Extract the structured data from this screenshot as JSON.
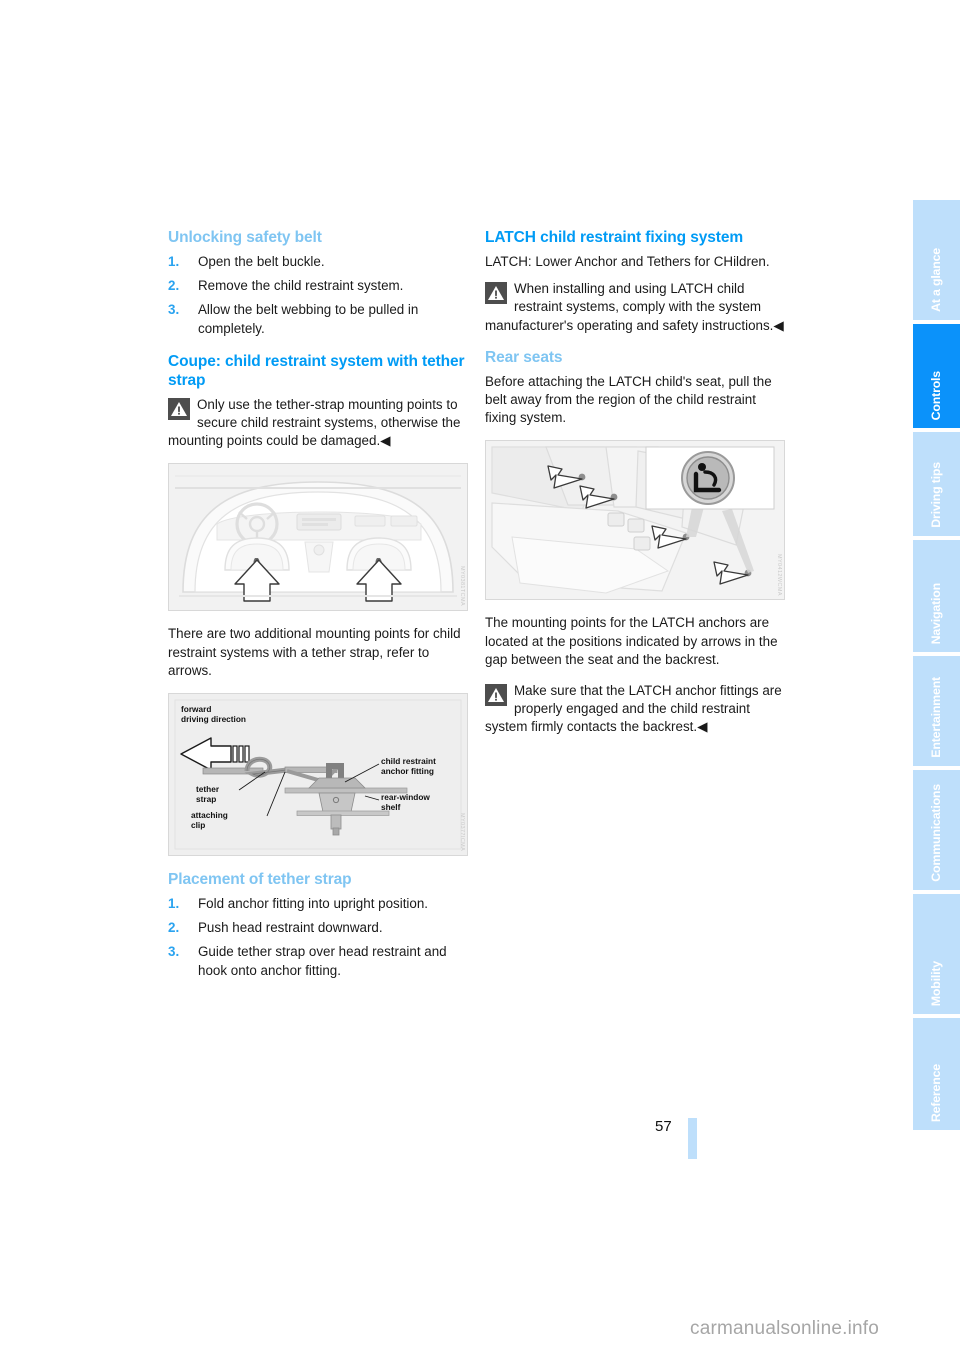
{
  "page": {
    "number": "57",
    "watermark": "carmanualsonline.info"
  },
  "sidebar": {
    "items": [
      {
        "label": "At a glance",
        "active": false
      },
      {
        "label": "Controls",
        "active": true
      },
      {
        "label": "Driving tips",
        "active": false
      },
      {
        "label": "Navigation",
        "active": false
      },
      {
        "label": "Entertainment",
        "active": false
      },
      {
        "label": "Communications",
        "active": false
      },
      {
        "label": "Mobility",
        "active": false
      },
      {
        "label": "Reference",
        "active": false
      }
    ],
    "colors": {
      "inactive": "#bedffb",
      "active": "#0b92fa",
      "text": "#ffffff"
    }
  },
  "colors": {
    "heading_main": "#009bf5",
    "heading_sub": "#7fc5f2",
    "list_number": "#2aa3f0",
    "body_text": "#1a1a1a"
  },
  "left_column": {
    "section1": {
      "heading": "Unlocking safety belt",
      "steps": [
        {
          "num": "1.",
          "text": "Open the belt buckle."
        },
        {
          "num": "2.",
          "text": "Remove the child restraint system."
        },
        {
          "num": "3.",
          "text": "Allow the belt webbing to be pulled in completely."
        }
      ]
    },
    "section2": {
      "heading": "Coupe: child restraint system with tether strap",
      "warning": "Only use the tether-strap mounting points to secure child restraint systems, otherwise the mounting points could be damaged.",
      "warning_endmark": "◀",
      "figure1": {
        "name": "coupe-rear-interior-mounting-points",
        "code": "MY0381TCMA"
      },
      "paragraph": "There are two additional mounting points for child restraint systems with a tether strap, refer to arrows.",
      "figure2": {
        "name": "tether-strap-anchor-fitting-diagram",
        "code": "MY0377ICMA",
        "labels": {
          "forward": "forward\ndriving direction",
          "tether_strap": "tether\nstrap",
          "attaching_clip": "attaching\nclip",
          "anchor_fitting": "child restraint\nanchor fitting",
          "rear_window_shelf": "rear-window\nshelf"
        }
      }
    },
    "section3": {
      "heading": "Placement of tether strap",
      "steps": [
        {
          "num": "1.",
          "text": "Fold anchor fitting into upright position."
        },
        {
          "num": "2.",
          "text": "Push head restraint downward."
        },
        {
          "num": "3.",
          "text": "Guide tether strap over head restraint and hook onto anchor fitting."
        }
      ]
    }
  },
  "right_column": {
    "section1": {
      "heading": "LATCH child restraint fixing system",
      "paragraph": "LATCH: Lower Anchor and Tethers for CHildren.",
      "warning": "When installing and using LATCH child restraint systems, comply with the system manufacturer's operating and safety instructions.",
      "warning_endmark": "◀"
    },
    "section2": {
      "heading": "Rear seats",
      "paragraph": "Before attaching the LATCH child's seat, pull the belt away from the region of the child restraint fixing system.",
      "figure": {
        "name": "rear-seat-latch-anchor-positions",
        "code": "MY0412WCMA"
      },
      "paragraph2": "The mounting points for the LATCH anchors are located at the positions indicated by arrows in the gap between the seat and the backrest.",
      "warning": "Make sure that the LATCH anchor fittings are properly engaged and the child restraint system firmly contacts the backrest.",
      "warning_endmark": "◀"
    }
  }
}
